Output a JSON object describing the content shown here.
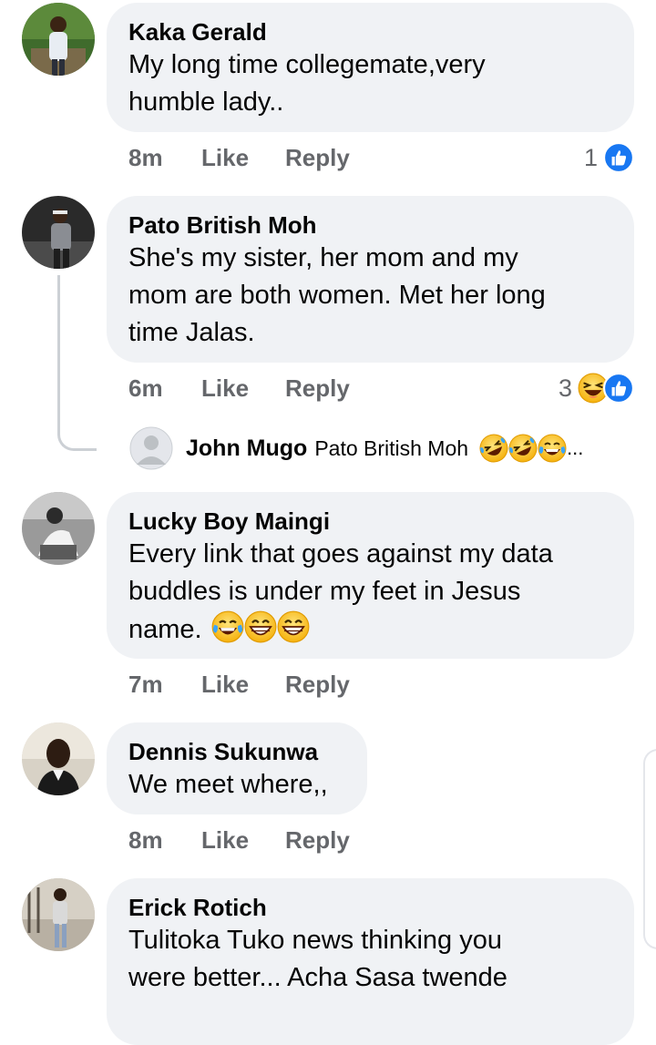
{
  "comments": [
    {
      "name": "Kaka Gerald",
      "text": "My long time collegemate,very\nhumble lady..",
      "time": "8m",
      "like": "Like",
      "reply": "Reply",
      "reaction_count": "1"
    },
    {
      "name": "Pato British Moh",
      "text": "She's my sister, her mom and my\nmom are both women. Met her long\ntime Jalas.",
      "time": "6m",
      "like": "Like",
      "reply": "Reply",
      "reaction_count": "3"
    },
    {
      "name": "Lucky Boy Maingi",
      "text": "Every link that goes against my data\nbuddles is under my feet in Jesus\nname.",
      "time": "7m",
      "like": "Like",
      "reply": "Reply"
    },
    {
      "name": "Dennis Sukunwa",
      "text": "We meet where,,",
      "time": "8m",
      "like": "Like",
      "reply": "Reply"
    },
    {
      "name": "Erick Rotich",
      "text": "Tulitoka Tuko news thinking you\nwere better... Acha Sasa twende"
    }
  ],
  "reply": {
    "name": "John Mugo",
    "text": "Pato British Moh",
    "ellipsis": "..."
  },
  "icons": {
    "like_reaction": "like-thumb-icon",
    "haha_reaction": "laughing-emoji-icon",
    "rofl": "rolling-laughing-emoji-icon",
    "tears": "tears-of-joy-emoji-icon",
    "grin": "grinning-emoji-icon"
  },
  "colors": {
    "bubble": "#f0f2f5",
    "meta": "#65676b",
    "like_blue": "#1877f2",
    "thread_line": "#ccd0d5"
  }
}
